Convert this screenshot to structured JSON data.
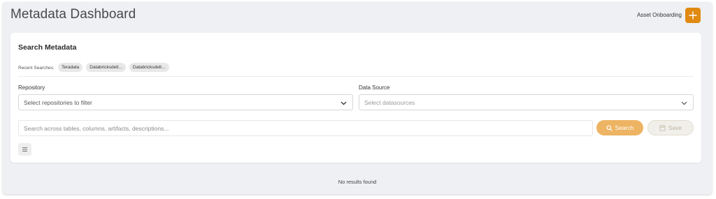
{
  "header": {
    "title": "Metadata Dashboard",
    "onboarding_label": "Asset Onboarding",
    "onboarding_icon": "plus-icon",
    "accent_color": "#e08a12"
  },
  "search_card": {
    "title": "Search Metadata",
    "recent_label": "Recent Searches:",
    "recent_searches": [
      "Teradata",
      "Databricksdelt...",
      "Databricksdelt..."
    ],
    "repository": {
      "label": "Repository",
      "value": "Select repositories to filter"
    },
    "datasource": {
      "label": "Data Source",
      "placeholder": "Select datasources"
    },
    "query": {
      "placeholder": "Search across tables, columns, artifacts, descriptions..."
    },
    "search_button": {
      "label": "Search",
      "icon": "search-icon",
      "color": "#edb463"
    },
    "save_button": {
      "label": "Save",
      "icon": "save-icon"
    },
    "menu_icon": "menu-icon"
  },
  "results": {
    "status": "No results found"
  }
}
